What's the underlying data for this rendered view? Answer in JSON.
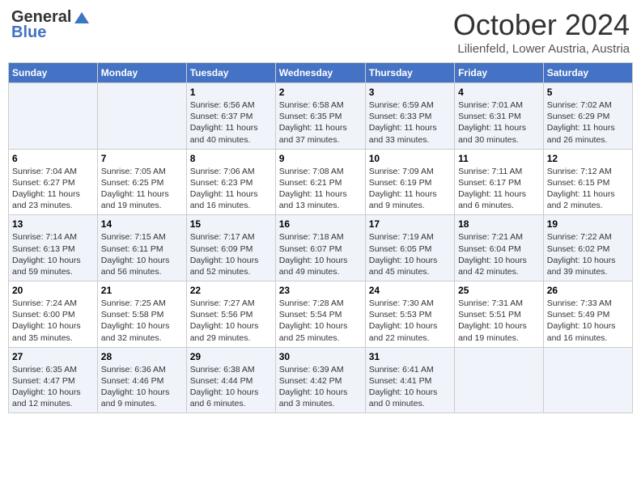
{
  "header": {
    "logo_general": "General",
    "logo_blue": "Blue",
    "month": "October 2024",
    "location": "Lilienfeld, Lower Austria, Austria"
  },
  "weekdays": [
    "Sunday",
    "Monday",
    "Tuesday",
    "Wednesday",
    "Thursday",
    "Friday",
    "Saturday"
  ],
  "weeks": [
    [
      {
        "day": "",
        "sunrise": "",
        "sunset": "",
        "daylight": ""
      },
      {
        "day": "",
        "sunrise": "",
        "sunset": "",
        "daylight": ""
      },
      {
        "day": "1",
        "sunrise": "Sunrise: 6:56 AM",
        "sunset": "Sunset: 6:37 PM",
        "daylight": "Daylight: 11 hours and 40 minutes."
      },
      {
        "day": "2",
        "sunrise": "Sunrise: 6:58 AM",
        "sunset": "Sunset: 6:35 PM",
        "daylight": "Daylight: 11 hours and 37 minutes."
      },
      {
        "day": "3",
        "sunrise": "Sunrise: 6:59 AM",
        "sunset": "Sunset: 6:33 PM",
        "daylight": "Daylight: 11 hours and 33 minutes."
      },
      {
        "day": "4",
        "sunrise": "Sunrise: 7:01 AM",
        "sunset": "Sunset: 6:31 PM",
        "daylight": "Daylight: 11 hours and 30 minutes."
      },
      {
        "day": "5",
        "sunrise": "Sunrise: 7:02 AM",
        "sunset": "Sunset: 6:29 PM",
        "daylight": "Daylight: 11 hours and 26 minutes."
      }
    ],
    [
      {
        "day": "6",
        "sunrise": "Sunrise: 7:04 AM",
        "sunset": "Sunset: 6:27 PM",
        "daylight": "Daylight: 11 hours and 23 minutes."
      },
      {
        "day": "7",
        "sunrise": "Sunrise: 7:05 AM",
        "sunset": "Sunset: 6:25 PM",
        "daylight": "Daylight: 11 hours and 19 minutes."
      },
      {
        "day": "8",
        "sunrise": "Sunrise: 7:06 AM",
        "sunset": "Sunset: 6:23 PM",
        "daylight": "Daylight: 11 hours and 16 minutes."
      },
      {
        "day": "9",
        "sunrise": "Sunrise: 7:08 AM",
        "sunset": "Sunset: 6:21 PM",
        "daylight": "Daylight: 11 hours and 13 minutes."
      },
      {
        "day": "10",
        "sunrise": "Sunrise: 7:09 AM",
        "sunset": "Sunset: 6:19 PM",
        "daylight": "Daylight: 11 hours and 9 minutes."
      },
      {
        "day": "11",
        "sunrise": "Sunrise: 7:11 AM",
        "sunset": "Sunset: 6:17 PM",
        "daylight": "Daylight: 11 hours and 6 minutes."
      },
      {
        "day": "12",
        "sunrise": "Sunrise: 7:12 AM",
        "sunset": "Sunset: 6:15 PM",
        "daylight": "Daylight: 11 hours and 2 minutes."
      }
    ],
    [
      {
        "day": "13",
        "sunrise": "Sunrise: 7:14 AM",
        "sunset": "Sunset: 6:13 PM",
        "daylight": "Daylight: 10 hours and 59 minutes."
      },
      {
        "day": "14",
        "sunrise": "Sunrise: 7:15 AM",
        "sunset": "Sunset: 6:11 PM",
        "daylight": "Daylight: 10 hours and 56 minutes."
      },
      {
        "day": "15",
        "sunrise": "Sunrise: 7:17 AM",
        "sunset": "Sunset: 6:09 PM",
        "daylight": "Daylight: 10 hours and 52 minutes."
      },
      {
        "day": "16",
        "sunrise": "Sunrise: 7:18 AM",
        "sunset": "Sunset: 6:07 PM",
        "daylight": "Daylight: 10 hours and 49 minutes."
      },
      {
        "day": "17",
        "sunrise": "Sunrise: 7:19 AM",
        "sunset": "Sunset: 6:05 PM",
        "daylight": "Daylight: 10 hours and 45 minutes."
      },
      {
        "day": "18",
        "sunrise": "Sunrise: 7:21 AM",
        "sunset": "Sunset: 6:04 PM",
        "daylight": "Daylight: 10 hours and 42 minutes."
      },
      {
        "day": "19",
        "sunrise": "Sunrise: 7:22 AM",
        "sunset": "Sunset: 6:02 PM",
        "daylight": "Daylight: 10 hours and 39 minutes."
      }
    ],
    [
      {
        "day": "20",
        "sunrise": "Sunrise: 7:24 AM",
        "sunset": "Sunset: 6:00 PM",
        "daylight": "Daylight: 10 hours and 35 minutes."
      },
      {
        "day": "21",
        "sunrise": "Sunrise: 7:25 AM",
        "sunset": "Sunset: 5:58 PM",
        "daylight": "Daylight: 10 hours and 32 minutes."
      },
      {
        "day": "22",
        "sunrise": "Sunrise: 7:27 AM",
        "sunset": "Sunset: 5:56 PM",
        "daylight": "Daylight: 10 hours and 29 minutes."
      },
      {
        "day": "23",
        "sunrise": "Sunrise: 7:28 AM",
        "sunset": "Sunset: 5:54 PM",
        "daylight": "Daylight: 10 hours and 25 minutes."
      },
      {
        "day": "24",
        "sunrise": "Sunrise: 7:30 AM",
        "sunset": "Sunset: 5:53 PM",
        "daylight": "Daylight: 10 hours and 22 minutes."
      },
      {
        "day": "25",
        "sunrise": "Sunrise: 7:31 AM",
        "sunset": "Sunset: 5:51 PM",
        "daylight": "Daylight: 10 hours and 19 minutes."
      },
      {
        "day": "26",
        "sunrise": "Sunrise: 7:33 AM",
        "sunset": "Sunset: 5:49 PM",
        "daylight": "Daylight: 10 hours and 16 minutes."
      }
    ],
    [
      {
        "day": "27",
        "sunrise": "Sunrise: 6:35 AM",
        "sunset": "Sunset: 4:47 PM",
        "daylight": "Daylight: 10 hours and 12 minutes."
      },
      {
        "day": "28",
        "sunrise": "Sunrise: 6:36 AM",
        "sunset": "Sunset: 4:46 PM",
        "daylight": "Daylight: 10 hours and 9 minutes."
      },
      {
        "day": "29",
        "sunrise": "Sunrise: 6:38 AM",
        "sunset": "Sunset: 4:44 PM",
        "daylight": "Daylight: 10 hours and 6 minutes."
      },
      {
        "day": "30",
        "sunrise": "Sunrise: 6:39 AM",
        "sunset": "Sunset: 4:42 PM",
        "daylight": "Daylight: 10 hours and 3 minutes."
      },
      {
        "day": "31",
        "sunrise": "Sunrise: 6:41 AM",
        "sunset": "Sunset: 4:41 PM",
        "daylight": "Daylight: 10 hours and 0 minutes."
      },
      {
        "day": "",
        "sunrise": "",
        "sunset": "",
        "daylight": ""
      },
      {
        "day": "",
        "sunrise": "",
        "sunset": "",
        "daylight": ""
      }
    ]
  ]
}
